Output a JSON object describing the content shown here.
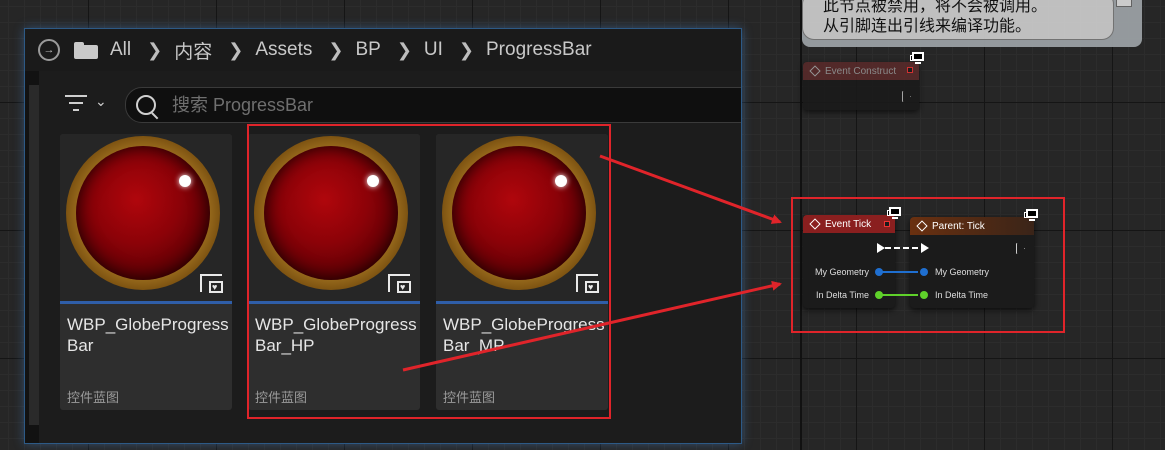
{
  "browser": {
    "breadcrumbs": [
      "All",
      "内容",
      "Assets",
      "BP",
      "UI",
      "ProgressBar"
    ],
    "search_placeholder": "搜索 ProgressBar",
    "assets": [
      {
        "name": "WBP_GlobeProgressBar",
        "type": "控件蓝图"
      },
      {
        "name": "WBP_GlobeProgressBar_HP",
        "type": "控件蓝图"
      },
      {
        "name": "WBP_GlobeProgressBar_MP",
        "type": "控件蓝图"
      }
    ]
  },
  "graph": {
    "comment": {
      "line1": "此节点被禁用，将不会被调用。",
      "line2": "从引脚连出引线来编译功能。"
    },
    "event_construct": {
      "title": "Event Construct"
    },
    "event_tick": {
      "title": "Event Tick",
      "pins": [
        "My Geometry",
        "In Delta Time"
      ]
    },
    "parent_tick": {
      "title": "Parent: Tick",
      "pins": [
        "My Geometry",
        "In Delta Time"
      ]
    }
  },
  "colors": {
    "accent_blue": "#2f5ea8",
    "highlight_red": "#e0242a",
    "event_header": "#8a1f1f",
    "parent_header": "#7a3a12",
    "struct_pin": "#1f6fd0",
    "float_pin": "#5fd12a"
  }
}
